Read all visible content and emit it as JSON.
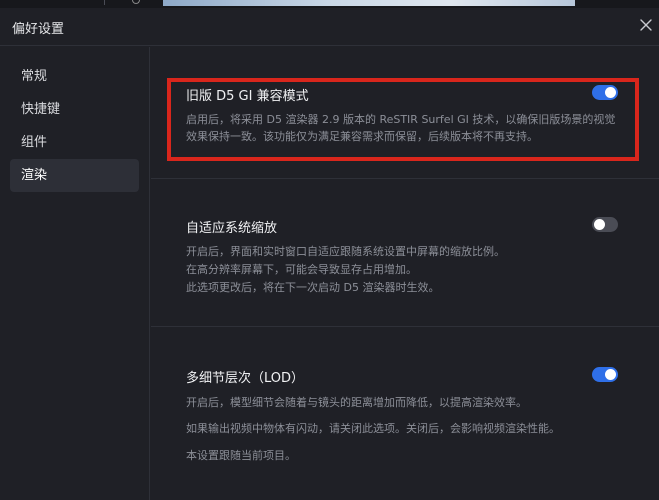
{
  "header": {
    "title": "偏好设置"
  },
  "sidebar": {
    "items": [
      {
        "label": "常规",
        "active": false
      },
      {
        "label": "快捷键",
        "active": false
      },
      {
        "label": "组件",
        "active": false
      },
      {
        "label": "渲染",
        "active": true
      }
    ]
  },
  "settings": {
    "legacy_gi": {
      "title": "旧版 D5 GI 兼容模式",
      "description": "启用后，将采用 D5 渲染器 2.9 版本的 ReSTIR Surfel GI 技术，以确保旧版场景的视觉效果保持一致。该功能仅为满足兼容需求而保留，后续版本将不再支持。",
      "enabled": true
    },
    "adaptive_scaling": {
      "title": "自适应系统缩放",
      "lines": [
        "开启后，界面和实时窗口自适应跟随系统设置中屏幕的缩放比例。",
        "在高分辨率屏幕下，可能会导致显存占用增加。",
        "此选项更改后，将在下一次启动 D5 渲染器时生效。"
      ],
      "enabled": false
    },
    "lod": {
      "title": "多细节层次（LOD）",
      "lines": [
        "开启后，模型细节会随着与镜头的距离增加而降低，以提高渲染效率。",
        "如果输出视频中物体有闪动，请关闭此选项。关闭后，会影响视频渲染性能。",
        "本设置跟随当前项目。"
      ],
      "enabled": true
    }
  },
  "colors": {
    "accent": "#2f6fe8",
    "highlight": "#d9261c",
    "background": "#1f2026"
  },
  "icons": {
    "close": "close-icon"
  }
}
